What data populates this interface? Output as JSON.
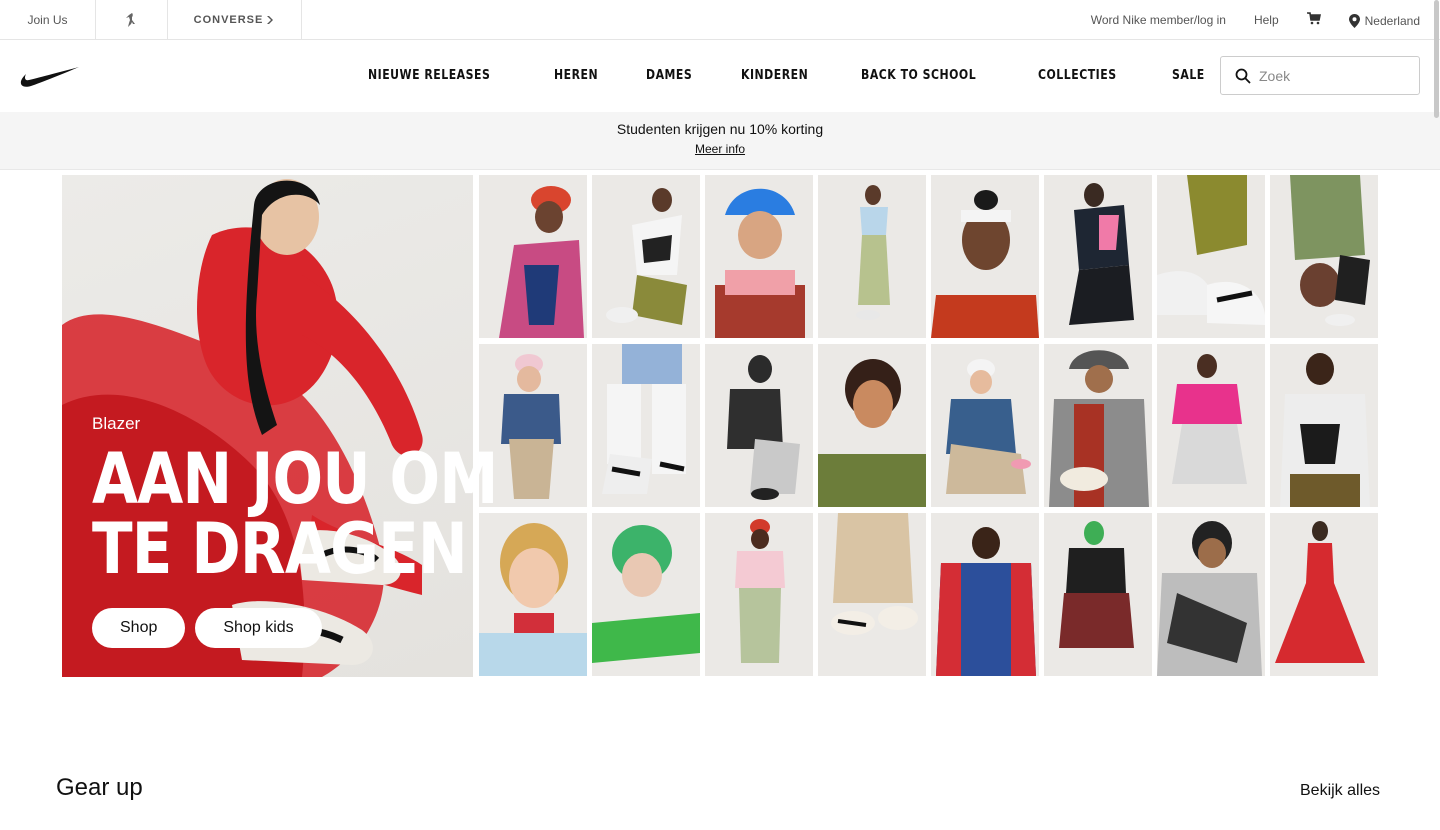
{
  "utility": {
    "join": "Join Us",
    "converse": "CONVERSE",
    "member": "Word Nike member/log in",
    "help": "Help",
    "locale": "Nederland"
  },
  "nav": {
    "links": [
      "NIEUWE RELEASES",
      "HEREN",
      "DAMES",
      "KINDEREN",
      "BACK TO SCHOOL",
      "COLLECTIES",
      "SALE"
    ],
    "search_placeholder": "Zoek"
  },
  "promo": {
    "title": "Studenten krijgen nu 10% korting",
    "link": "Meer info"
  },
  "hero": {
    "subtitle": "Blazer",
    "title": "AAN JOU OM TE DRAGEN",
    "buttons": [
      "Shop",
      "Shop kids"
    ]
  },
  "gear": {
    "title": "Gear up",
    "link": "Bekijk alles"
  },
  "colors": {
    "accent_red": "#d61f26",
    "text": "#111111",
    "muted": "#555555"
  }
}
